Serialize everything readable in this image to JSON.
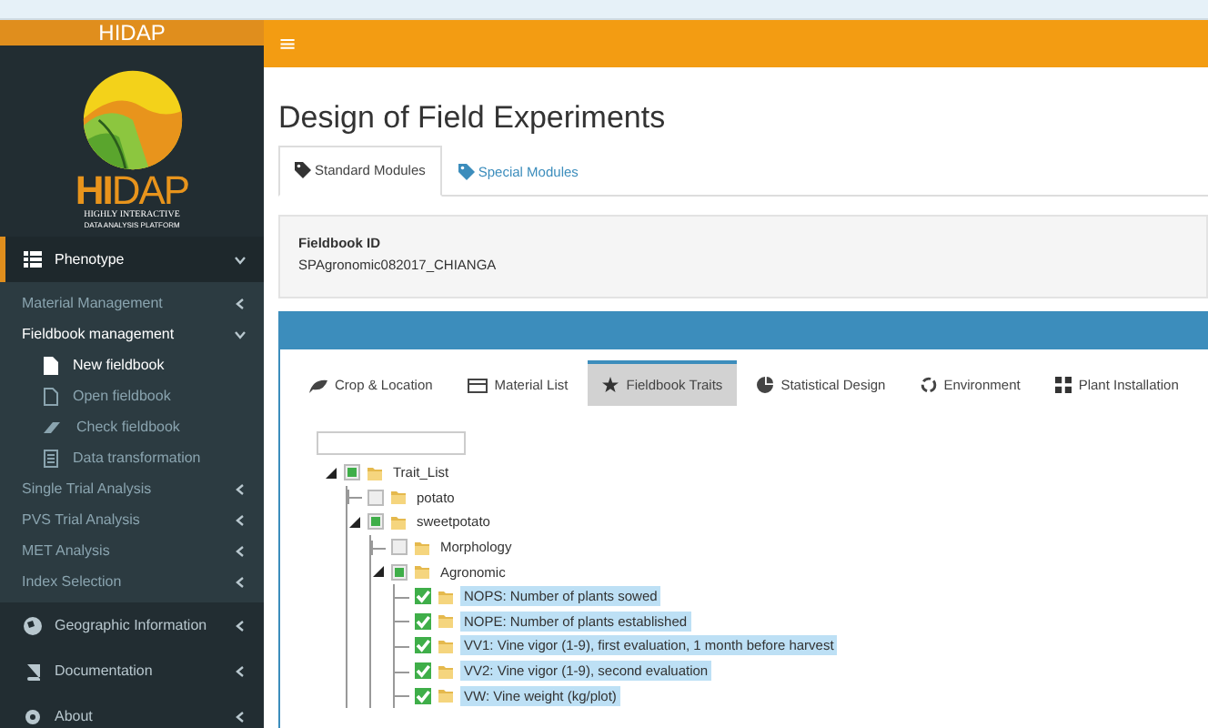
{
  "header": {
    "brand": "HIDAP",
    "menu_glyph": "≡"
  },
  "logo": {
    "letters_a": "HI",
    "letters_b": "DAP",
    "line1": "HIGHLY INTERACTIVE",
    "line2": "DATA ANALYSIS PLATFORM"
  },
  "sidebar": {
    "items": [
      {
        "label": "Phenotype",
        "kind": "table",
        "expanded": true,
        "children": [
          {
            "label": "Material Management",
            "expanded": false
          },
          {
            "label": "Fieldbook management",
            "expanded": true,
            "children": [
              {
                "label": "New fieldbook",
                "kind": "file",
                "selected": true
              },
              {
                "label": "Open fieldbook",
                "kind": "outline",
                "selected": false
              },
              {
                "label": "Check fieldbook",
                "kind": "eraser",
                "selected": false
              },
              {
                "label": "Data transformation",
                "kind": "doc",
                "selected": false
              }
            ]
          },
          {
            "label": "Single Trial Analysis",
            "expanded": false
          },
          {
            "label": "PVS Trial Analysis",
            "expanded": false
          },
          {
            "label": "MET Analysis",
            "expanded": false
          },
          {
            "label": "Index Selection",
            "expanded": false
          }
        ]
      },
      {
        "label": "Geographic Information",
        "kind": "globe",
        "expanded": false
      },
      {
        "label": "Documentation",
        "kind": "book",
        "expanded": false
      },
      {
        "label": "About",
        "kind": "gear",
        "expanded": false
      }
    ]
  },
  "page": {
    "title": "Design of Field Experiments"
  },
  "module_tabs": [
    {
      "label": "Standard Modules",
      "selected": true
    },
    {
      "label": "Special Modules",
      "selected": false
    }
  ],
  "fieldbook": {
    "label": "Fieldbook ID",
    "value": "SPAgronomic082017_CHIANGA"
  },
  "step_tabs": [
    {
      "label": "Crop & Location",
      "kind": "leaf",
      "selected": false
    },
    {
      "label": "Material List",
      "kind": "list",
      "selected": false
    },
    {
      "label": "Fieldbook Traits",
      "kind": "star",
      "selected": true
    },
    {
      "label": "Statistical Design",
      "kind": "pie",
      "selected": false
    },
    {
      "label": "Environment",
      "kind": "recycle",
      "selected": false
    },
    {
      "label": "Plant Installation",
      "kind": "grid",
      "selected": false
    }
  ],
  "tree": {
    "nodes": [
      {
        "label": "Trait_List",
        "partial": true,
        "selected": false,
        "expanded": true,
        "children": [
          {
            "label": "potato",
            "checked": false,
            "selected": false,
            "expanded": false
          },
          {
            "label": "sweetpotato",
            "partial": true,
            "selected": false,
            "expanded": true,
            "children": [
              {
                "label": "Morphology",
                "checked": false,
                "selected": false,
                "expanded": false
              },
              {
                "label": "Agronomic",
                "partial": true,
                "selected": false,
                "expanded": true,
                "children": [
                  {
                    "label": "NOPS: Number of plants sowed",
                    "checked": true,
                    "selected": true
                  },
                  {
                    "label": "NOPE: Number of plants established",
                    "checked": true,
                    "selected": true
                  },
                  {
                    "label": "VV1: Vine vigor (1-9), first evaluation, 1 month before harvest",
                    "checked": true,
                    "selected": true
                  },
                  {
                    "label": "VV2: Vine vigor (1-9), second evaluation",
                    "checked": true,
                    "selected": true
                  },
                  {
                    "label": "VW: Vine weight (kg/plot)",
                    "checked": true,
                    "selected": true
                  }
                ]
              }
            ]
          }
        ]
      }
    ]
  }
}
